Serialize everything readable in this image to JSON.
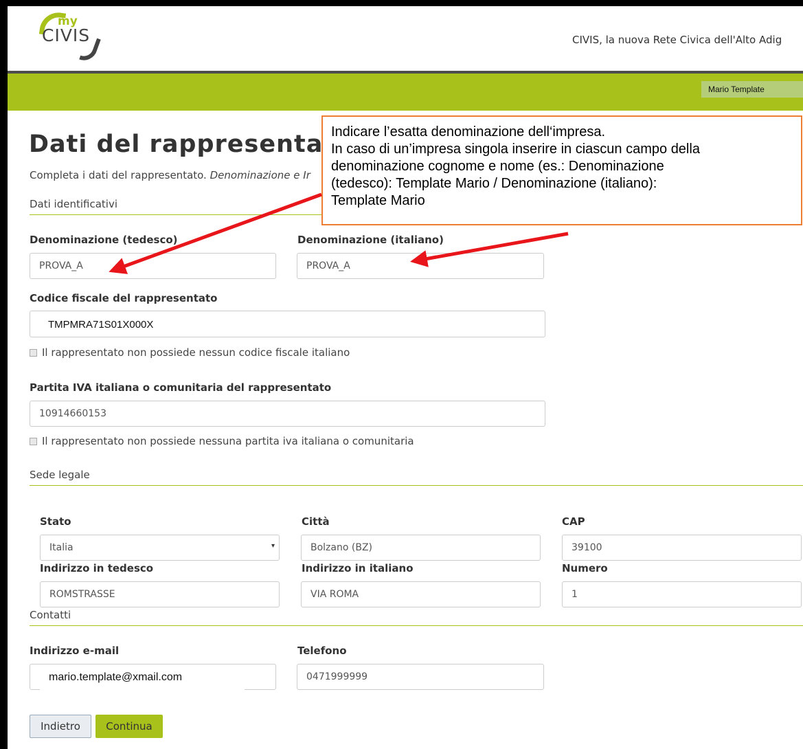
{
  "header": {
    "logo_my": "my",
    "logo_civis": "CIVIS",
    "tagline": "CIVIS, la nuova Rete Civica dell'Alto Adig",
    "user_name": "Mario Template"
  },
  "page": {
    "title": "Dati del rappresenta",
    "intro_plain": "Completa i dati del rappresentato. ",
    "intro_italic": "Denominazione e Ir"
  },
  "sections": {
    "identification": "Dati identificativi",
    "legal_seat": "Sede legale",
    "contacts": "Contatti"
  },
  "fields": {
    "name_de": {
      "label": "Denominazione (tedesco)",
      "value": "PROVA_A"
    },
    "name_it": {
      "label": "Denominazione (italiano)",
      "value": "PROVA_A"
    },
    "tax_code": {
      "label": "Codice fiscale del rappresentato",
      "value": "TMPMRA71S01X000X"
    },
    "no_tax_code": {
      "label": "Il rappresentato non possiede nessun codice fiscale italiano"
    },
    "vat": {
      "label": "Partita IVA italiana o comunitaria del rappresentato",
      "value": "10914660153"
    },
    "no_vat": {
      "label": "Il rappresentato non possiede nessuna partita iva italiana o comunitaria"
    },
    "state": {
      "label": "Stato",
      "value": "Italia"
    },
    "city": {
      "label": "Città",
      "value": "Bolzano (BZ)"
    },
    "zip": {
      "label": "CAP",
      "value": "39100"
    },
    "address_de": {
      "label": "Indirizzo in tedesco",
      "value": "ROMSTRASSE"
    },
    "address_it": {
      "label": "Indirizzo in italiano",
      "value": "VIA ROMA"
    },
    "number": {
      "label": "Numero",
      "value": "1"
    },
    "email": {
      "label": "Indirizzo e-mail",
      "value": "mario.template@xmail.com"
    },
    "phone": {
      "label": "Telefono",
      "value": "0471999999"
    }
  },
  "buttons": {
    "back": "Indietro",
    "next": "Continua"
  },
  "callout": {
    "line1": "Indicare l’esatta denominazione dell‘impresa.",
    "line2": "In caso di un’impresa singola inserire in ciascun campo della",
    "line3": "denominazione cognome e nome (es.: Denominazione",
    "line4": "(tedesco): Template Mario / Denominazione (italiano):",
    "line5": "Template Mario"
  },
  "colors": {
    "brand_green": "#a9c21b",
    "callout_border": "#ed7d31",
    "arrow": "#e8151b"
  },
  "icons": {
    "select_arrow": "chevron-down-icon"
  }
}
